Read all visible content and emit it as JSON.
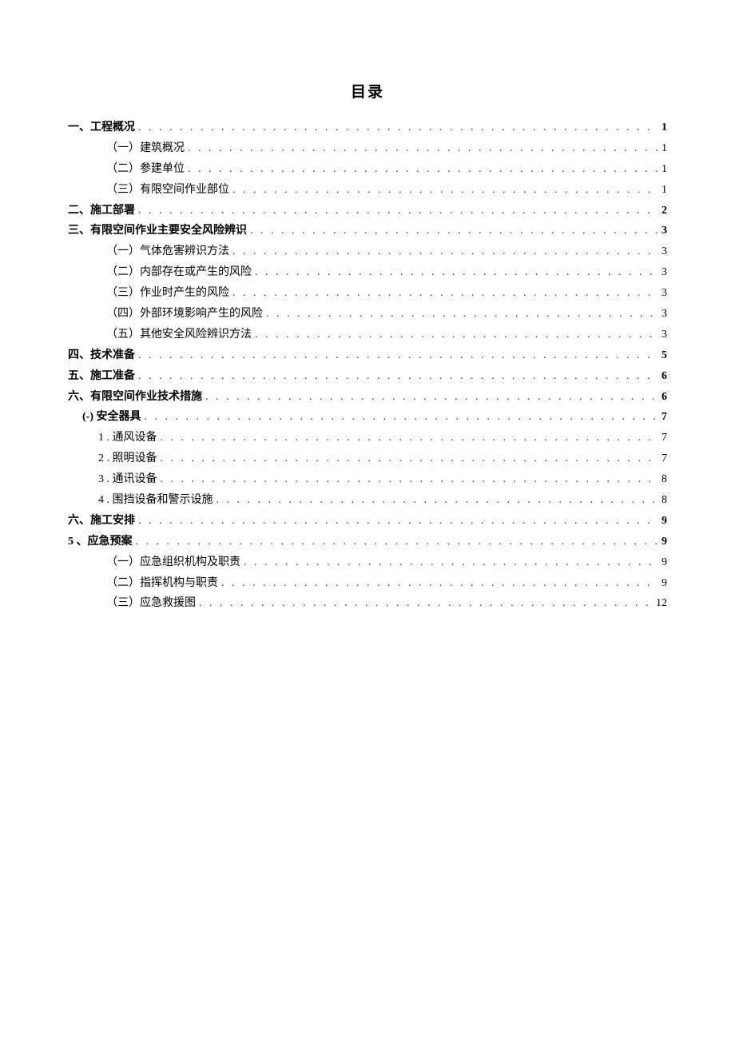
{
  "title": "目录",
  "entries": [
    {
      "label": "一、工程概况",
      "page": "1",
      "bold": true,
      "indent": "level-1"
    },
    {
      "label": "（一）建筑概况",
      "page": "1",
      "bold": false,
      "indent": "level-2"
    },
    {
      "label": "（二）参建单位",
      "page": "1",
      "bold": false,
      "indent": "level-2"
    },
    {
      "label": "（三）有限空间作业部位",
      "page": "1",
      "bold": false,
      "indent": "level-2"
    },
    {
      "label": "二、施工部署",
      "page": "2",
      "bold": true,
      "indent": "level-1"
    },
    {
      "label": "三、有限空间作业主要安全风险辨识",
      "page": "3",
      "bold": true,
      "indent": "level-1"
    },
    {
      "label": "（一）气体危害辨识方法",
      "page": "3",
      "bold": false,
      "indent": "level-2"
    },
    {
      "label": "（二）内部存在或产生的风险",
      "page": "3",
      "bold": false,
      "indent": "level-2"
    },
    {
      "label": "（三）作业时产生的风险",
      "page": "3",
      "bold": false,
      "indent": "level-2"
    },
    {
      "label": "（四）外部环境影响产生的风险",
      "page": "3",
      "bold": false,
      "indent": "level-2"
    },
    {
      "label": "（五）其他安全风险辨识方法",
      "page": "3",
      "bold": false,
      "indent": "level-2"
    },
    {
      "label": "四、技术准备",
      "page": "5",
      "bold": true,
      "indent": "level-1"
    },
    {
      "label": "五、施工准备",
      "page": "6",
      "bold": true,
      "indent": "level-1"
    },
    {
      "label": "六、有限空间作业技术措施",
      "page": "6",
      "bold": true,
      "indent": "level-1"
    },
    {
      "label": "(-) 安全器具",
      "page": "7",
      "bold": true,
      "indent": "level-2b"
    },
    {
      "label": "1  . 通风设备",
      "page": "7",
      "bold": false,
      "indent": "level-3"
    },
    {
      "label": "2  . 照明设备",
      "page": "7",
      "bold": false,
      "indent": "level-3"
    },
    {
      "label": "3  . 通讯设备",
      "page": "8",
      "bold": false,
      "indent": "level-3"
    },
    {
      "label": "4  . 围挡设备和警示设施",
      "page": "8",
      "bold": false,
      "indent": "level-3"
    },
    {
      "label": "六、施工安排",
      "page": "9",
      "bold": true,
      "indent": "level-1"
    },
    {
      "label": "5    、应急预案",
      "page": "9",
      "bold": true,
      "indent": "level-5"
    },
    {
      "label": "（一）应急组织机构及职责",
      "page": "9",
      "bold": false,
      "indent": "level-2"
    },
    {
      "label": "（二）指挥机构与职责",
      "page": "9",
      "bold": false,
      "indent": "level-2"
    },
    {
      "label": "（三）应急救援图",
      "page": "12",
      "bold": false,
      "indent": "level-2"
    }
  ],
  "dots": ". . . . . . . . . . . . . . . . . . . . . . . . . . . . . . . . . . . . . . . . . . . . . . . . . . . . . . . . . . . . . . . . . . . . . . . . . . . . . . . . . . . . . . . . . . . . . . . . . . . . . . . . . . . . . . . . . . . . . . . . . . . . . . . . . . . . . . . . . . . . . . . . . . . . . . . . . . . . . . . . . . . . . . . . . . . . . . . ."
}
